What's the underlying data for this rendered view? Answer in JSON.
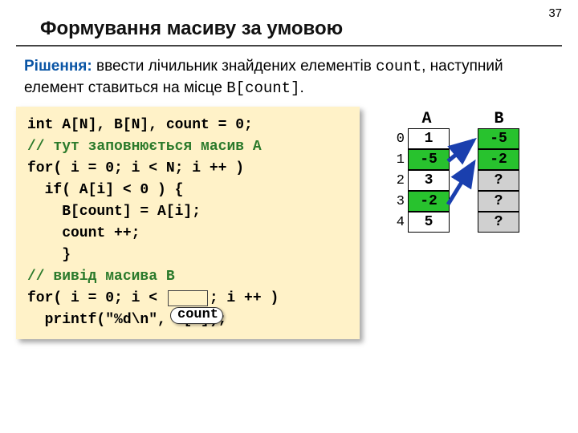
{
  "page_number": "37",
  "title": "Формування масиву за умовою",
  "desc": {
    "kw": "Рішення:",
    "text1": " ввести лічильник знайдених елементів ",
    "count_code": "count",
    "text2": ", наступний елемент ставиться на місце ",
    "bcount_code": "B[count]",
    "text3": "."
  },
  "code": {
    "l1": "int A[N], B[N], count = 0;",
    "l2": "// тут заповнюється масив A",
    "l3": "for( i = 0; i < N; i ++ )",
    "l4": "  if( A[i] < 0 ) {",
    "l5": "    B[count] = A[i];",
    "l6": "    count ++;",
    "l7": "    }",
    "l8": "// вивід масива B",
    "l9a": "for( i = 0; i < ",
    "l9b": "; i ++ )",
    "l10": "  printf(\"%d\\n\", B[i]);"
  },
  "count_label": "count",
  "arrays": {
    "label_a": "A",
    "label_b": "B",
    "rows": [
      {
        "idx": "0",
        "a": "1",
        "a_green": false,
        "b": "-5",
        "b_class": "green"
      },
      {
        "idx": "1",
        "a": "-5",
        "a_green": true,
        "b": "-2",
        "b_class": "green"
      },
      {
        "idx": "2",
        "a": "3",
        "a_green": false,
        "b": "?",
        "b_class": "gray"
      },
      {
        "idx": "3",
        "a": "-2",
        "a_green": true,
        "b": "?",
        "b_class": "gray"
      },
      {
        "idx": "4",
        "a": "5",
        "a_green": false,
        "b": "?",
        "b_class": "gray"
      }
    ]
  }
}
